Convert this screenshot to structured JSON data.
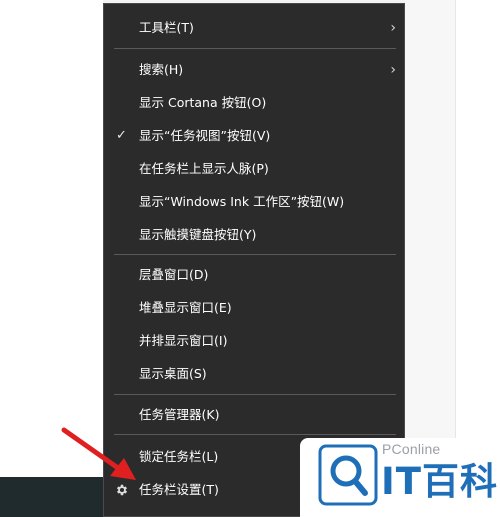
{
  "context_menu": {
    "items": [
      {
        "label": "工具栏(T)",
        "submenu": true
      },
      {
        "label": "搜索(H)",
        "submenu": true
      },
      {
        "label": "显示 Cortana 按钮(O)"
      },
      {
        "label": "显示“任务视图”按钮(V)",
        "checked": true
      },
      {
        "label": "在任务栏上显示人脉(P)"
      },
      {
        "label": "显示“Windows Ink 工作区”按钮(W)"
      },
      {
        "label": "显示触摸键盘按钮(Y)"
      },
      {
        "label": "层叠窗口(D)"
      },
      {
        "label": "堆叠显示窗口(E)"
      },
      {
        "label": "并排显示窗口(I)"
      },
      {
        "label": "显示桌面(S)"
      },
      {
        "label": "任务管理器(K)"
      },
      {
        "label": "锁定任务栏(L)"
      },
      {
        "label": "任务栏设置(T)",
        "icon": "gear-icon"
      }
    ]
  },
  "icons": {
    "chevron": "›",
    "check": "✓"
  },
  "watermark": {
    "brand": "PConline",
    "name": "IT百科"
  },
  "colors": {
    "menu_background": "#2b2b2b",
    "menu_text": "#ffffff",
    "separator": "#5a5a5a",
    "arrow": "#e02020",
    "watermark_blue": "#1f6fb8"
  }
}
